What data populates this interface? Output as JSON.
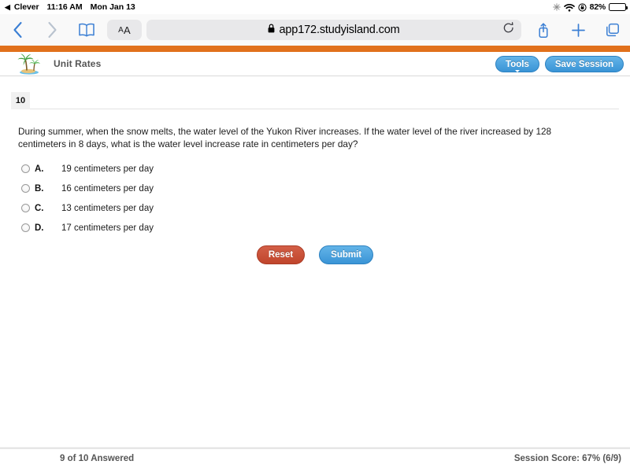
{
  "status_bar": {
    "back_arrow_icon": "triangle-left-icon",
    "source_app": "Clever",
    "time": "11:16 AM",
    "date": "Mon Jan 13",
    "icons": [
      "bluetooth-sync-icon",
      "wifi-icon",
      "rotation-lock-icon"
    ],
    "battery_percent_label": "82%",
    "battery_percent_value": 82
  },
  "browser": {
    "back_icon": "chevron-left-icon",
    "forward_icon": "chevron-right-icon",
    "bookmarks_icon": "book-icon",
    "text_size_label": "AA",
    "lock_icon": "lock-icon",
    "url": "app172.studyisland.com",
    "reload_icon": "reload-icon",
    "share_icon": "share-icon",
    "new_tab_icon": "plus-icon",
    "tabs_icon": "tabs-icon"
  },
  "app_header": {
    "logo_icon": "palm-island-logo-icon",
    "title": "Unit Rates",
    "tools_label": "Tools",
    "save_session_label": "Save Session",
    "accent_color": "#e1711c",
    "button_color": "#3a94d6"
  },
  "question": {
    "number_tab": "10",
    "text": "During summer, when the snow melts, the water level of the Yukon River increases. If the water level of the river increased by 128 centimeters in 8 days, what is the water level increase rate in centimeters per day?",
    "options": [
      {
        "letter": "A.",
        "text": "19 centimeters per day",
        "selected": false
      },
      {
        "letter": "B.",
        "text": "16 centimeters per day",
        "selected": false
      },
      {
        "letter": "C.",
        "text": "13 centimeters per day",
        "selected": false
      },
      {
        "letter": "D.",
        "text": "17 centimeters per day",
        "selected": false
      }
    ],
    "reset_label": "Reset",
    "submit_label": "Submit"
  },
  "footer": {
    "progress_label": "9 of 10 Answered",
    "score_label": "Session Score: 67% (6/9)"
  }
}
